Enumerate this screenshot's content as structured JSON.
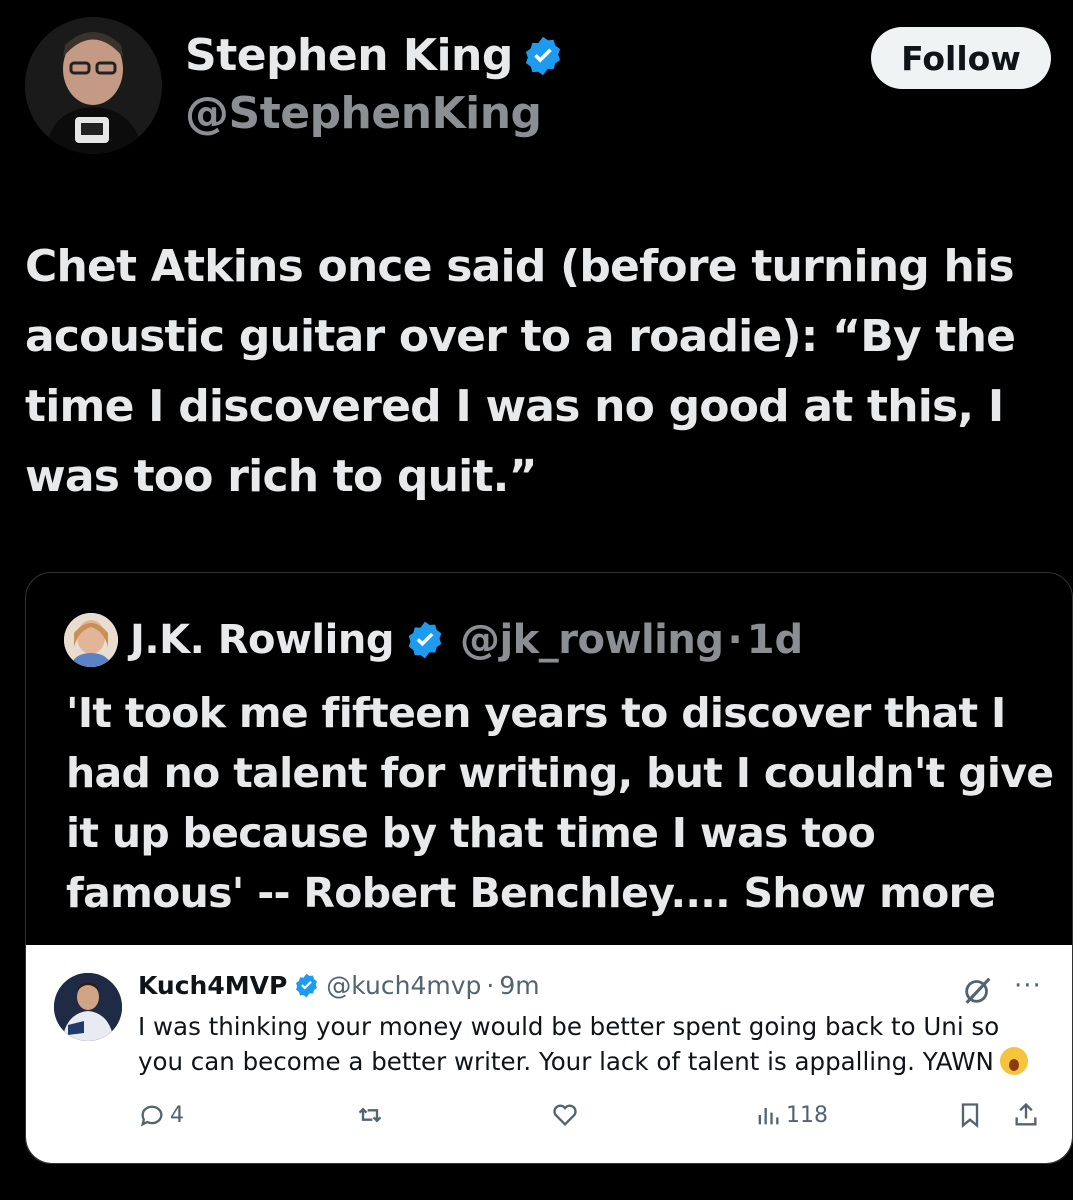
{
  "author": {
    "name": "Stephen King",
    "handle": "@StephenKing",
    "follow_label": "Follow"
  },
  "tweet": {
    "text": "Chet Atkins once said (before turning his acoustic guitar over to a roadie): “By the time I discovered I was no good at this, I was too rich to quit.”"
  },
  "quoted": {
    "name": "J.K. Rowling",
    "handle": "@jk_rowling",
    "separator": "·",
    "time": "1d",
    "text": "'It took me fifteen years to discover that I had no talent for writing, but I couldn't give it up because by that time I was too famous' -- Robert Benchley....",
    "show_more": "Show more"
  },
  "reply": {
    "name": "Kuch4MVP",
    "handle": "@kuch4mvp",
    "separator": "·",
    "time": "9m",
    "text": "I was thinking your money would be better spent going back to Uni so you can become a better writer. Your lack of talent is appalling. YAWN",
    "replies": "4",
    "views": "118",
    "more_label": "···"
  },
  "colors": {
    "verified_blue": "#1d9bf0",
    "background": "#000000",
    "reply_bg": "#ffffff"
  },
  "icons": [
    "verified-badge-icon",
    "grok-icon",
    "more-icon",
    "reply-icon",
    "retweet-icon",
    "like-icon",
    "views-icon",
    "bookmark-icon",
    "share-icon",
    "yawn-emoji-icon"
  ]
}
